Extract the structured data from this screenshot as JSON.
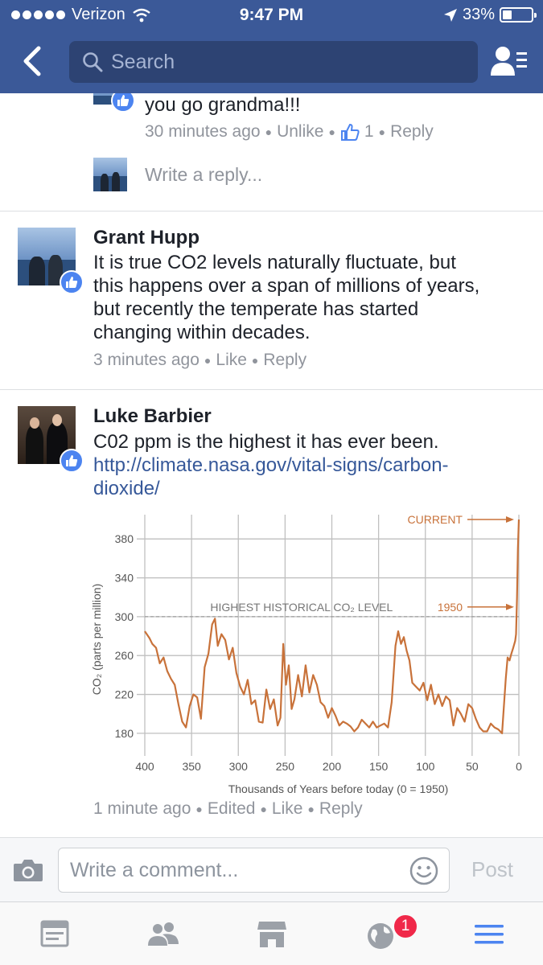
{
  "status_bar": {
    "carrier": "Verizon",
    "time": "9:47 PM",
    "battery": "33%",
    "battery_level": 0.33
  },
  "search": {
    "placeholder": "Search"
  },
  "reply_thread": {
    "text": "you go grandma!!!",
    "time": "30 minutes ago",
    "unlike": "Unlike",
    "like_count": "1",
    "reply": "Reply",
    "write_reply": "Write a reply..."
  },
  "comments": [
    {
      "author": "Grant Hupp",
      "lines": [
        "It is true CO2 levels naturally fluctuate, but",
        "this happens over a span of millions of years,",
        "but recently the temperate has started",
        "changing within decades."
      ],
      "time": "3 minutes ago",
      "like": "Like",
      "reply": "Reply"
    },
    {
      "author": "Luke Barbier",
      "text": "C02 ppm is the highest it has ever been.",
      "link_lines": [
        "http://climate.nasa.gov/vital-signs/carbon-",
        "dioxide/"
      ],
      "time": "1 minute ago",
      "edited": "Edited",
      "like": "Like",
      "reply": "Reply"
    }
  ],
  "composer": {
    "placeholder": "Write a comment...",
    "post": "Post"
  },
  "tabbar": {
    "notifications_badge": "1"
  },
  "colors": {
    "brand": "#3b5998",
    "chart_line": "#c8723a",
    "link": "#365899"
  },
  "chart_data": {
    "type": "line",
    "xlabel": "Thousands of Years before today (0 = 1950)",
    "ylabel": "CO₂ (parts per million)",
    "xlim": [
      400,
      0
    ],
    "ylim": [
      165,
      405
    ],
    "x_ticks": [
      400,
      350,
      300,
      250,
      200,
      150,
      100,
      50,
      0
    ],
    "y_ticks": [
      180,
      220,
      260,
      300,
      340,
      380
    ],
    "grid": true,
    "reference_line": {
      "value": 300,
      "label": "HIGHEST HISTORICAL CO₂ LEVEL"
    },
    "annotations": [
      {
        "label": "CURRENT",
        "x": 0,
        "y": 400
      },
      {
        "label": "1950",
        "x": 0,
        "y": 310
      }
    ],
    "series": [
      {
        "x": [
          400,
          395,
          392,
          388,
          384,
          380,
          376,
          372,
          368,
          364,
          360,
          356,
          352,
          348,
          344,
          340,
          336,
          332,
          328,
          325,
          322,
          318,
          314,
          310,
          306,
          302,
          298,
          294,
          290,
          286,
          282,
          278,
          274,
          270,
          266,
          262,
          258,
          255,
          252,
          249,
          246,
          243,
          240,
          236,
          232,
          228,
          224,
          220,
          216,
          212,
          208,
          204,
          200,
          196,
          192,
          188,
          184,
          180,
          176,
          172,
          168,
          164,
          160,
          156,
          152,
          148,
          144,
          140,
          136,
          132,
          129,
          126,
          123,
          120,
          117,
          114,
          110,
          106,
          102,
          98,
          94,
          90,
          86,
          82,
          78,
          74,
          70,
          66,
          62,
          58,
          54,
          50,
          46,
          42,
          38,
          34,
          30,
          26,
          22,
          18,
          14,
          12,
          10,
          8,
          6,
          4,
          3,
          2,
          1,
          0.5,
          0
        ],
        "values": [
          285,
          278,
          272,
          268,
          252,
          258,
          244,
          236,
          230,
          210,
          192,
          186,
          208,
          220,
          217,
          195,
          248,
          262,
          292,
          298,
          270,
          282,
          276,
          256,
          268,
          242,
          228,
          220,
          235,
          210,
          214,
          192,
          191,
          225,
          205,
          215,
          188,
          196,
          272,
          230,
          250,
          205,
          215,
          240,
          218,
          250,
          222,
          240,
          230,
          212,
          208,
          196,
          206,
          198,
          188,
          192,
          190,
          187,
          182,
          186,
          194,
          190,
          186,
          192,
          186,
          188,
          190,
          186,
          212,
          270,
          285,
          272,
          279,
          265,
          255,
          232,
          228,
          224,
          232,
          214,
          230,
          210,
          220,
          208,
          218,
          214,
          188,
          206,
          200,
          192,
          210,
          206,
          195,
          186,
          182,
          182,
          190,
          186,
          184,
          180,
          236,
          258,
          255,
          262,
          268,
          275,
          282,
          320,
          370,
          385,
          400
        ]
      }
    ]
  }
}
